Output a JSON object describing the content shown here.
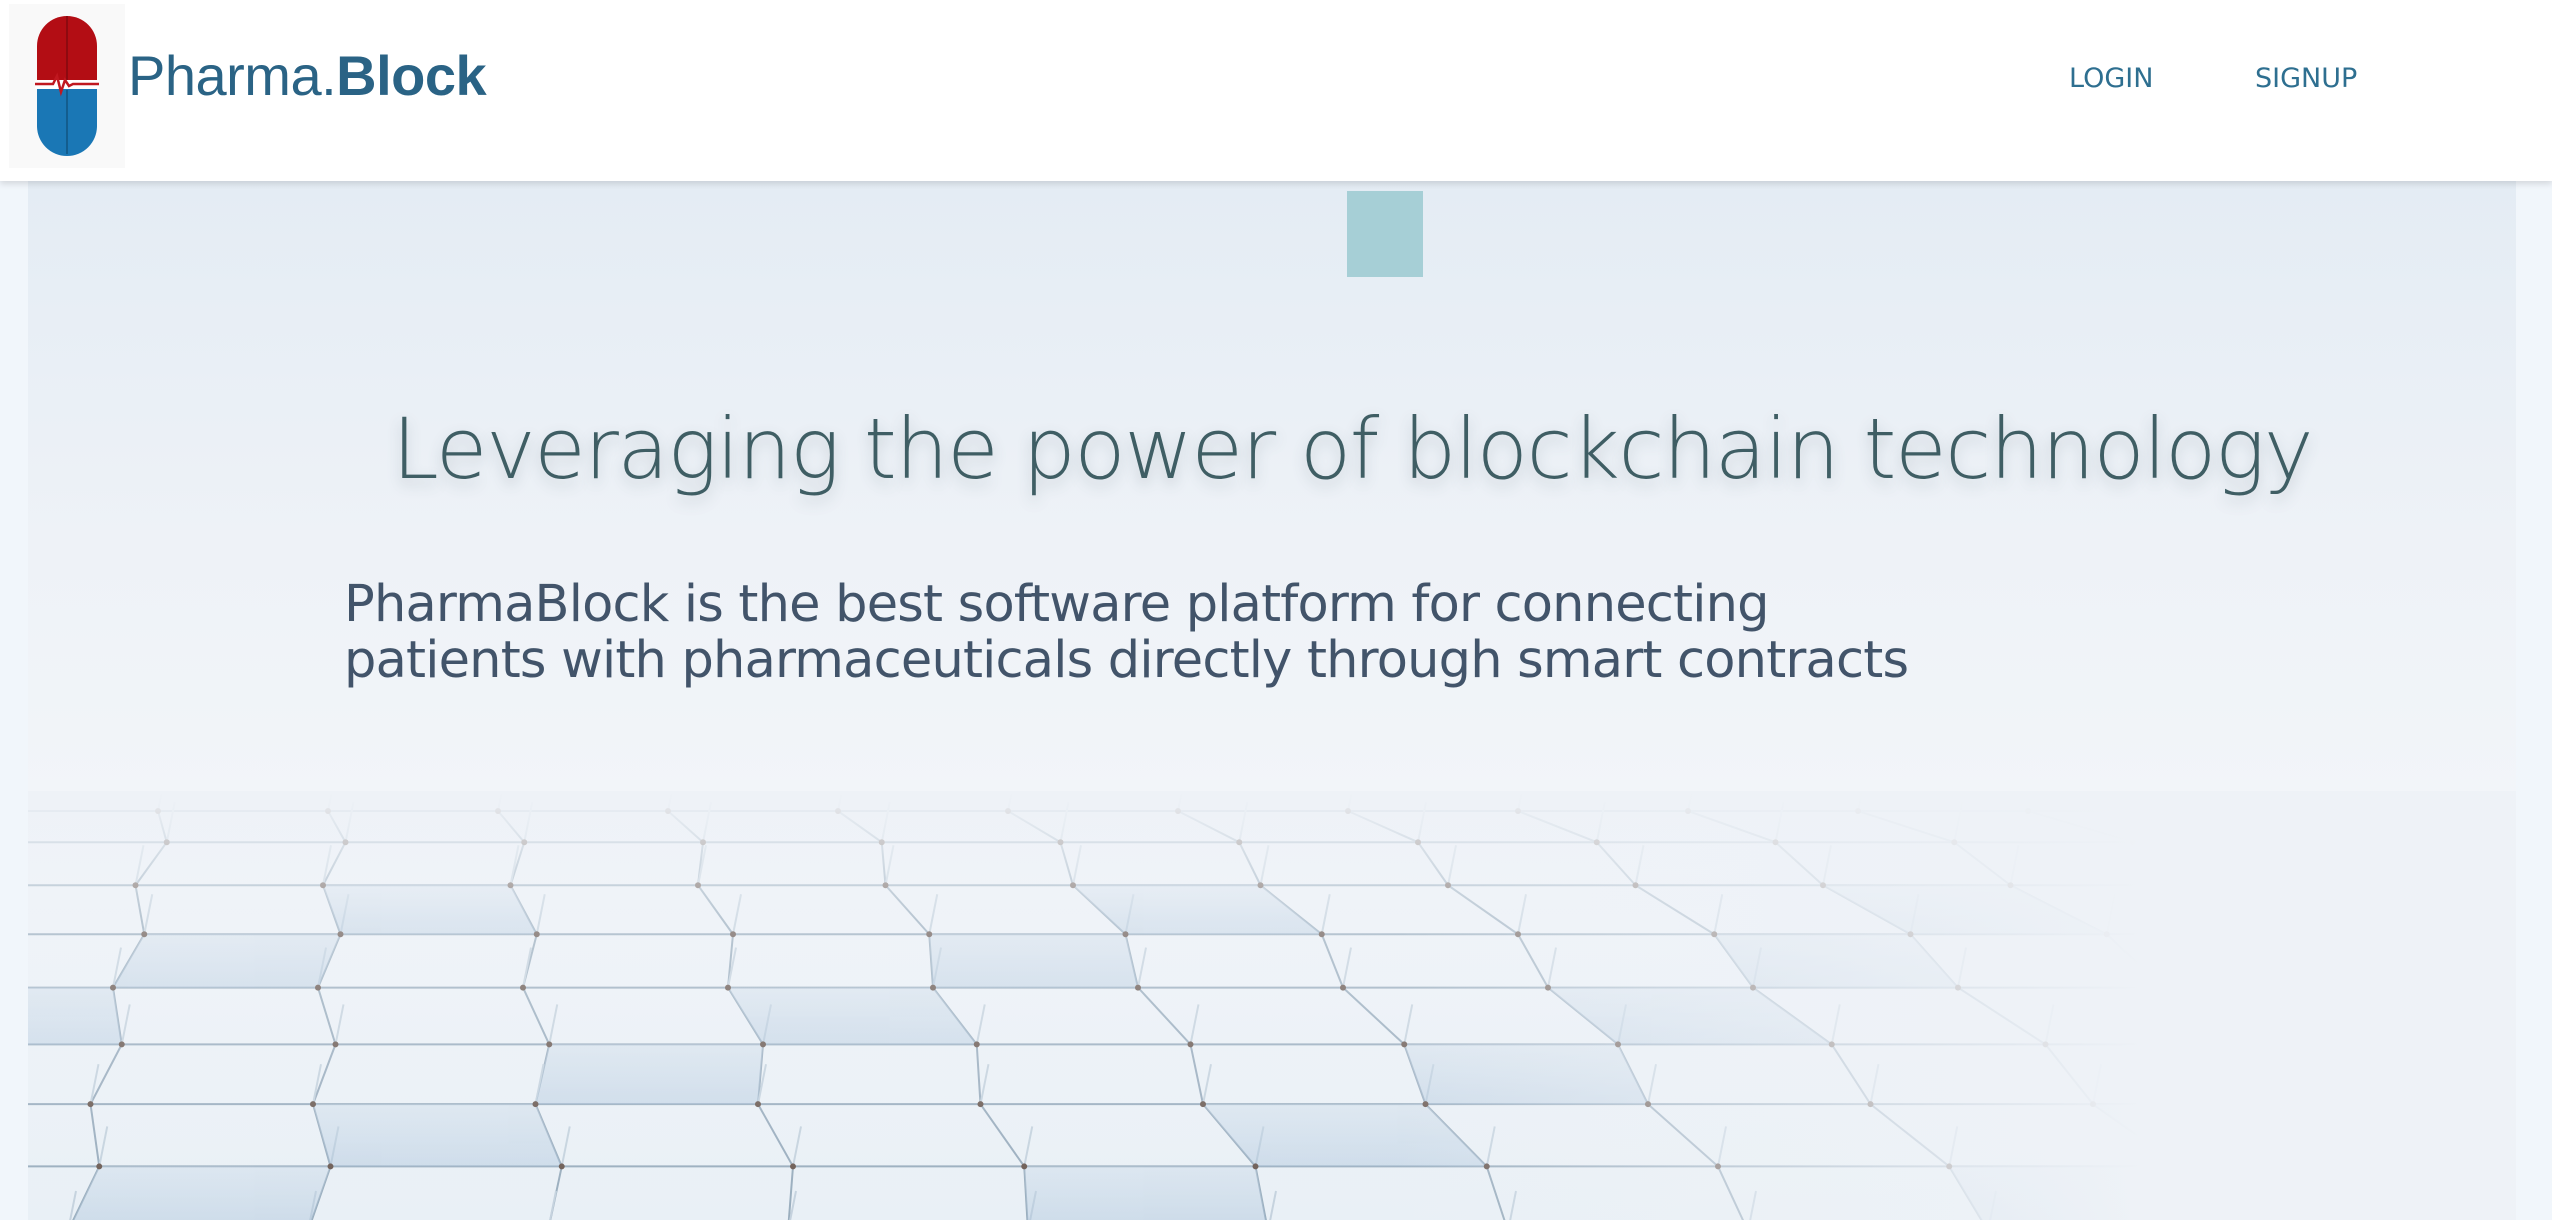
{
  "header": {
    "brand_light": "Pharma.",
    "brand_bold": "Block",
    "nav": {
      "login": "LOGIN",
      "signup": "SIGNUP"
    }
  },
  "hero": {
    "headline": "Leveraging the power of blockchain technology",
    "subtext_line1": "PharmaBlock is the best software platform for connecting",
    "subtext_line2": "patients with pharmaceuticals directly through smart contracts"
  },
  "colors": {
    "brand_blue": "#2a6385",
    "pill_red": "#b30d14",
    "pill_blue": "#1a77b5",
    "accent_square": "#a6cfd6",
    "headline": "#3f5e64"
  },
  "icons": {
    "logo": "pill-heartbeat-icon"
  }
}
